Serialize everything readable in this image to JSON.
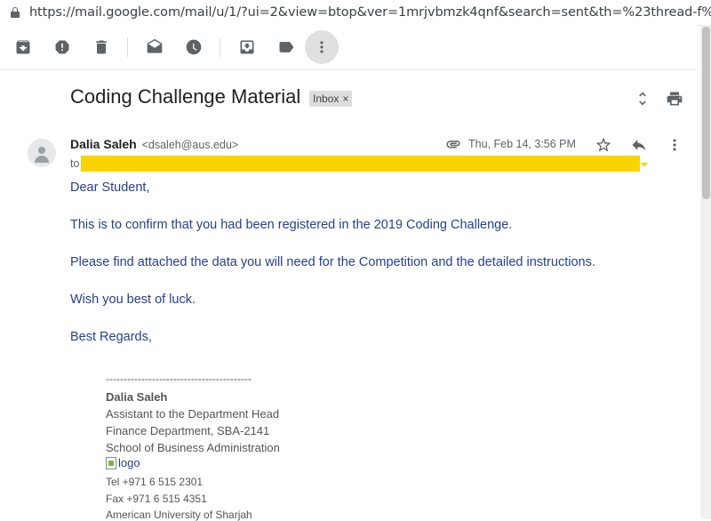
{
  "browser": {
    "url": "https://mail.google.com/mail/u/1/?ui=2&view=btop&ver=1mrjvbmzk4qnf&search=sent&th=%23thread-f%3A162544..."
  },
  "toolbar": {
    "buttons": [
      "archive-icon",
      "report-spam-icon",
      "delete-icon",
      "mark-unread-icon",
      "snooze-icon",
      "move-to-icon",
      "labels-icon",
      "more-vert-icon"
    ]
  },
  "email": {
    "subject": "Coding Challenge Material",
    "label_chip": "Inbox",
    "label_chip_close": "×",
    "sender_name": "Dalia Saleh",
    "sender_email": "<dsaleh@aus.edu>",
    "to_prefix": "to",
    "date": "Thu, Feb 14, 3:56 PM",
    "body": [
      "Dear Student,",
      "This is to confirm that you had been registered in the 2019 Coding Challenge.",
      "Please find attached the data you will need for the Competition and the detailed instructions.",
      "Wish you best of luck.",
      "Best Regards,"
    ],
    "signature": {
      "divider": "-----------------------------------------",
      "name": "Dalia Saleh",
      "title": "Assistant to the Department Head",
      "department": "Finance Department, SBA-2141",
      "school": "School of Business Administration",
      "logo_alt": "logo",
      "tel": "Tel +971 6 515 2301",
      "fax": "Fax +971 6 515 4351",
      "university": "American University of Sharjah"
    }
  },
  "colors": {
    "body_text": "#26418f",
    "redaction": "#fad400"
  }
}
